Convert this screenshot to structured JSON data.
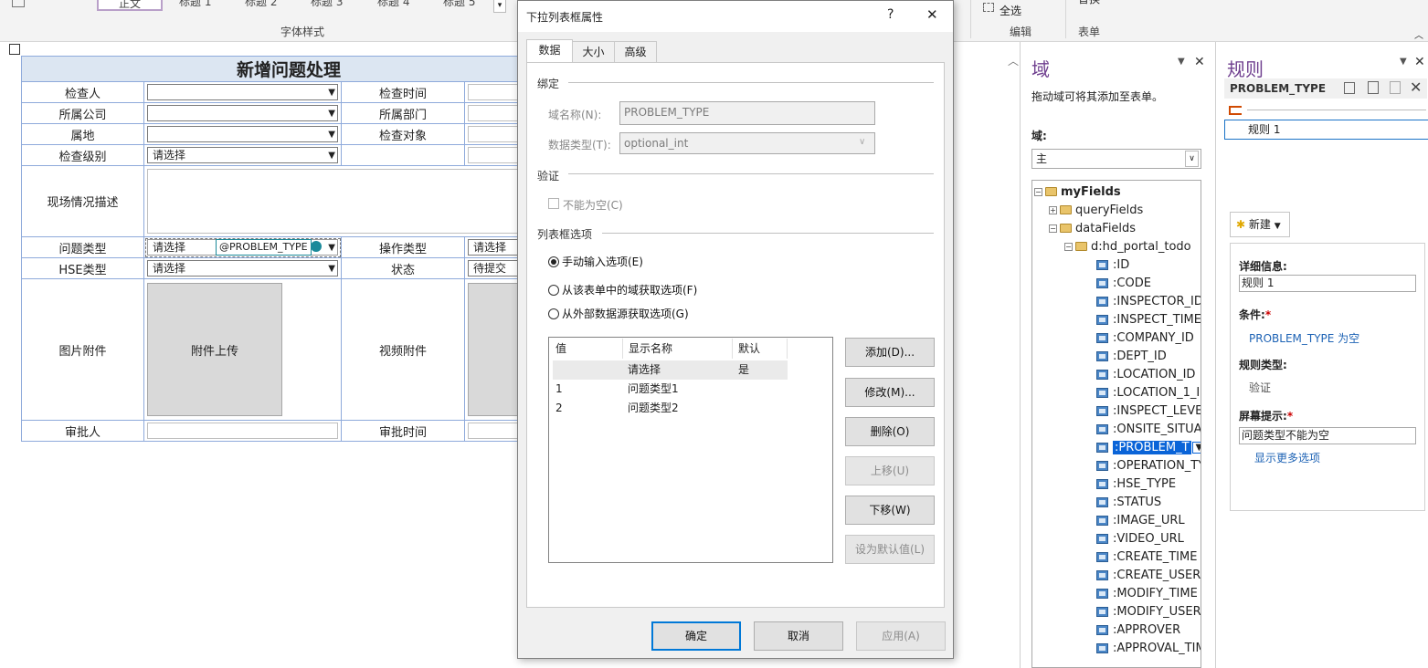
{
  "ribbon": {
    "styles": [
      "正文",
      "标题 1",
      "标题 2",
      "标题 3",
      "标题 4",
      "标题 5"
    ],
    "group_font": "字体样式",
    "select_all": "全选",
    "group_edit": "编辑",
    "group_form": "表单",
    "replace": "替换"
  },
  "form": {
    "title": "新增问题处理",
    "rows": {
      "inspector": "检查人",
      "inspect_time": "检查时间",
      "company": "所属公司",
      "dept": "所属部门",
      "location": "属地",
      "inspect_object": "检查对象",
      "inspect_level": "检查级别",
      "inspect_level_value": "请选择",
      "onsite_desc": "现场情况描述",
      "problem_type": "问题类型",
      "problem_type_value": "请选择",
      "problem_type_binding": "@PROBLEM_TYPE",
      "operation_type": "操作类型",
      "operation_type_value": "请选择",
      "hse_type": "HSE类型",
      "hse_type_value": "请选择",
      "status": "状态",
      "status_value": "待提交",
      "image_attach": "图片附件",
      "image_upload": "附件上传",
      "video_attach": "视频附件",
      "approver": "审批人",
      "approval_time": "审批时间"
    }
  },
  "dialog": {
    "title": "下拉列表框属性",
    "help": "?",
    "close": "✕",
    "tabs": [
      "数据",
      "大小",
      "高级"
    ],
    "section_binding": "绑定",
    "field_name_label": "域名称(N):",
    "field_name_value": "PROBLEM_TYPE",
    "data_type_label": "数据类型(T):",
    "data_type_value": "optional_int",
    "section_validation": "验证",
    "not_empty_label": "不能为空(C)",
    "section_options": "列表框选项",
    "radio_manual": "手动输入选项(E)",
    "radio_form": "从该表单中的域获取选项(F)",
    "radio_external": "从外部数据源获取选项(G)",
    "list_headers": [
      "值",
      "显示名称",
      "默认"
    ],
    "list_rows": [
      {
        "value": "",
        "display": "请选择",
        "default": "是"
      },
      {
        "value": "1",
        "display": "问题类型1",
        "default": ""
      },
      {
        "value": "2",
        "display": "问题类型2",
        "default": ""
      }
    ],
    "btn_add": "添加(D)...",
    "btn_modify": "修改(M)...",
    "btn_delete": "删除(O)",
    "btn_up": "上移(U)",
    "btn_down": "下移(W)",
    "btn_default": "设为默认值(L)",
    "btn_ok": "确定",
    "btn_cancel": "取消",
    "btn_apply": "应用(A)"
  },
  "domain_pane": {
    "title": "域",
    "hint": "拖动域可将其添加至表单。",
    "field_label": "域:",
    "select_value": "主",
    "tree_root": "myFields",
    "tree_query": "queryFields",
    "tree_data": "dataFields",
    "tree_table": "d:hd_portal_todo",
    "fields": [
      ":ID",
      ":CODE",
      ":INSPECTOR_ID",
      ":INSPECT_TIME",
      ":COMPANY_ID",
      ":DEPT_ID",
      ":LOCATION_ID",
      ":LOCATION_1_ID",
      ":INSPECT_LEVEL",
      ":ONSITE_SITUAT",
      ":PROBLEM_T",
      ":OPERATION_TY",
      ":HSE_TYPE",
      ":STATUS",
      ":IMAGE_URL",
      ":VIDEO_URL",
      ":CREATE_TIME",
      ":CREATE_USER_I",
      ":MODIFY_TIME",
      ":MODIFY_USER_",
      ":APPROVER",
      ":APPROVAL_TIM"
    ],
    "selected_index": 10
  },
  "rules_pane": {
    "title": "规则",
    "field": "PROBLEM_TYPE",
    "rule_item": "规则 1",
    "new_button": "新建",
    "details_label": "详细信息:",
    "details_value": "规则 1",
    "condition_label": "条件:",
    "condition_value": "PROBLEM_TYPE 为空",
    "rule_type_label": "规则类型:",
    "rule_type_value": "验证",
    "screen_tip_label": "屏幕提示:",
    "screen_tip_value": "问题类型不能为空",
    "more_options": "显示更多选项",
    "required_mark": "*"
  },
  "colors": {
    "accent": "#0078d7",
    "selected": "#0a64d8",
    "pane_title": "#6f3f8f",
    "form_border": "#8eaadb"
  }
}
